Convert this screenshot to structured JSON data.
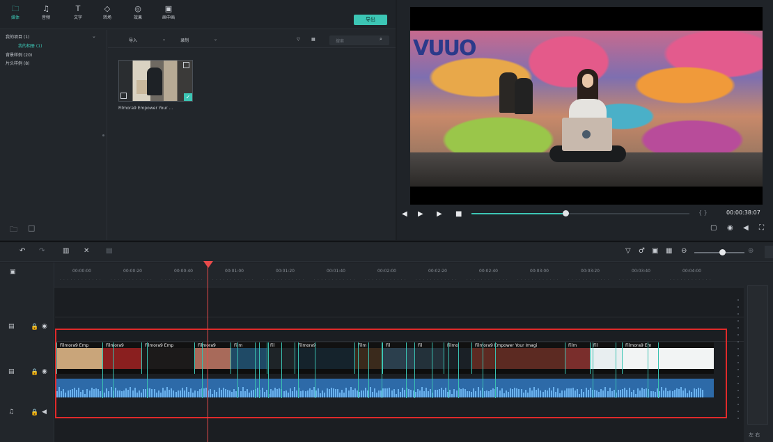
{
  "toolbar": {
    "items": [
      {
        "label": "媒体",
        "icon": "folder-icon",
        "active": true
      },
      {
        "label": "音频",
        "icon": "music-icon"
      },
      {
        "label": "文字",
        "icon": "text-icon"
      },
      {
        "label": "转场",
        "icon": "transition-icon"
      },
      {
        "label": "效果",
        "icon": "effects-icon"
      },
      {
        "label": "画中画",
        "icon": "pip-icon"
      }
    ],
    "export_label": "导出"
  },
  "library": {
    "tree": [
      {
        "label": "我的项目 (1)",
        "sub": false
      },
      {
        "label": "我的相册 (1)",
        "sub": true
      },
      {
        "label": "背景样例 (20)",
        "sub": false
      },
      {
        "label": "片头样例 (8)",
        "sub": false
      }
    ]
  },
  "media_bar": {
    "import_label": "导入",
    "record_label": "录制",
    "search_placeholder": "搜索"
  },
  "media": {
    "caption": "Filmora9 Empower Your ..."
  },
  "preview": {
    "graffiti": "VUUO",
    "timecode": "00:00:38:07",
    "bracket": "{  }",
    "progress": 0.43
  },
  "timeline": {
    "tick_labels": [
      "00:00:00",
      "00:00:20",
      "00:00:40",
      "00:01:00",
      "00:01:20",
      "00:01:40",
      "00:02:00",
      "00:02:20",
      "00:02:40",
      "00:03:00",
      "00:03:20",
      "00:03:40",
      "00:04:00",
      "00:04:20"
    ],
    "clips": [
      {
        "title": "Filmora9  Emp",
        "color": "#c9a57a"
      },
      {
        "title": "Filmora9",
        "color": "#8a1f1f"
      },
      {
        "title": "Filmora9  Emp",
        "color": "#1c1a1a"
      },
      {
        "title": "Filmora9",
        "color": "#a86a5a"
      },
      {
        "title": "Film",
        "color": "#1f4a66"
      },
      {
        "title": "Fil",
        "color": "#1e2428"
      },
      {
        "title": "Filmora9",
        "color": "#15232c"
      },
      {
        "title": "Film",
        "color": "#3a2a1c"
      },
      {
        "title": "Fil",
        "color": "#2b3f4d"
      },
      {
        "title": "Fil",
        "color": "#23313a"
      },
      {
        "title": "Filmo",
        "color": "#1a2026"
      },
      {
        "title": "Filmora9  Empower Your Imagi",
        "color": "#5c2a22"
      },
      {
        "title": "Film",
        "color": "#7a2e2c"
      },
      {
        "title": "Fil",
        "color": "#e8eef0"
      },
      {
        "title": "Filmora9  Em",
        "color": "#f2f4f4"
      }
    ],
    "zoom_level": 0.55,
    "lr_label": "左  右"
  }
}
